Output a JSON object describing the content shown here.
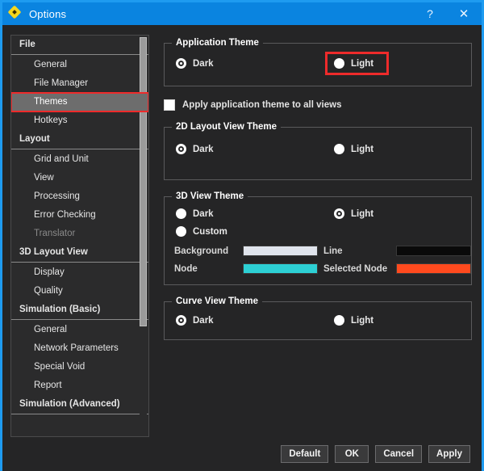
{
  "window": {
    "title": "Options",
    "icon": "diamond-icon",
    "help_label": "?",
    "close_label": "✕",
    "accent_color": "#0a84e0"
  },
  "sidebar": {
    "items": [
      {
        "label": "File",
        "type": "header",
        "state": "normal"
      },
      {
        "label": "General",
        "type": "item",
        "state": "normal"
      },
      {
        "label": "File Manager",
        "type": "item",
        "state": "normal"
      },
      {
        "label": "Themes",
        "type": "item",
        "state": "selected"
      },
      {
        "label": "Hotkeys",
        "type": "item",
        "state": "normal"
      },
      {
        "label": "Layout",
        "type": "header",
        "state": "normal"
      },
      {
        "label": "Grid and Unit",
        "type": "item",
        "state": "normal"
      },
      {
        "label": "View",
        "type": "item",
        "state": "normal"
      },
      {
        "label": "Processing",
        "type": "item",
        "state": "normal"
      },
      {
        "label": "Error Checking",
        "type": "item",
        "state": "normal"
      },
      {
        "label": "Translator",
        "type": "item",
        "state": "disabled"
      },
      {
        "label": "3D Layout View",
        "type": "header",
        "state": "normal"
      },
      {
        "label": "Display",
        "type": "item",
        "state": "normal"
      },
      {
        "label": "Quality",
        "type": "item",
        "state": "normal"
      },
      {
        "label": "Simulation (Basic)",
        "type": "header",
        "state": "normal"
      },
      {
        "label": "General",
        "type": "item",
        "state": "normal"
      },
      {
        "label": "Network Parameters",
        "type": "item",
        "state": "normal"
      },
      {
        "label": "Special Void",
        "type": "item",
        "state": "normal"
      },
      {
        "label": "Report",
        "type": "item",
        "state": "normal"
      },
      {
        "label": "Simulation (Advanced)",
        "type": "header",
        "state": "normal"
      }
    ],
    "selected": "Themes",
    "annotation_color": "#ee2b2b"
  },
  "application_theme": {
    "legend": "Application Theme",
    "dark_label": "Dark",
    "light_label": "Light",
    "selected": "Dark",
    "light_annotated": true
  },
  "apply_all_views": {
    "label": "Apply application theme to all views",
    "checked": false
  },
  "layout_2d_theme": {
    "legend": "2D Layout View Theme",
    "dark_label": "Dark",
    "light_label": "Light",
    "selected": "Dark"
  },
  "view_3d_theme": {
    "legend": "3D View Theme",
    "dark_label": "Dark",
    "light_label": "Light",
    "custom_label": "Custom",
    "selected": "Light",
    "swatches": {
      "background_label": "Background",
      "background_color": "#e0e4ec",
      "line_label": "Line",
      "line_color": "#0a0a0a",
      "node_label": "Node",
      "node_color": "#2dd0d4",
      "selected_node_label": "Selected Node",
      "selected_node_color": "#ff4a1e"
    }
  },
  "curve_view_theme": {
    "legend": "Curve View Theme",
    "dark_label": "Dark",
    "light_label": "Light",
    "selected": "Dark"
  },
  "footer": {
    "default_label": "Default",
    "ok_label": "OK",
    "cancel_label": "Cancel",
    "apply_label": "Apply"
  }
}
